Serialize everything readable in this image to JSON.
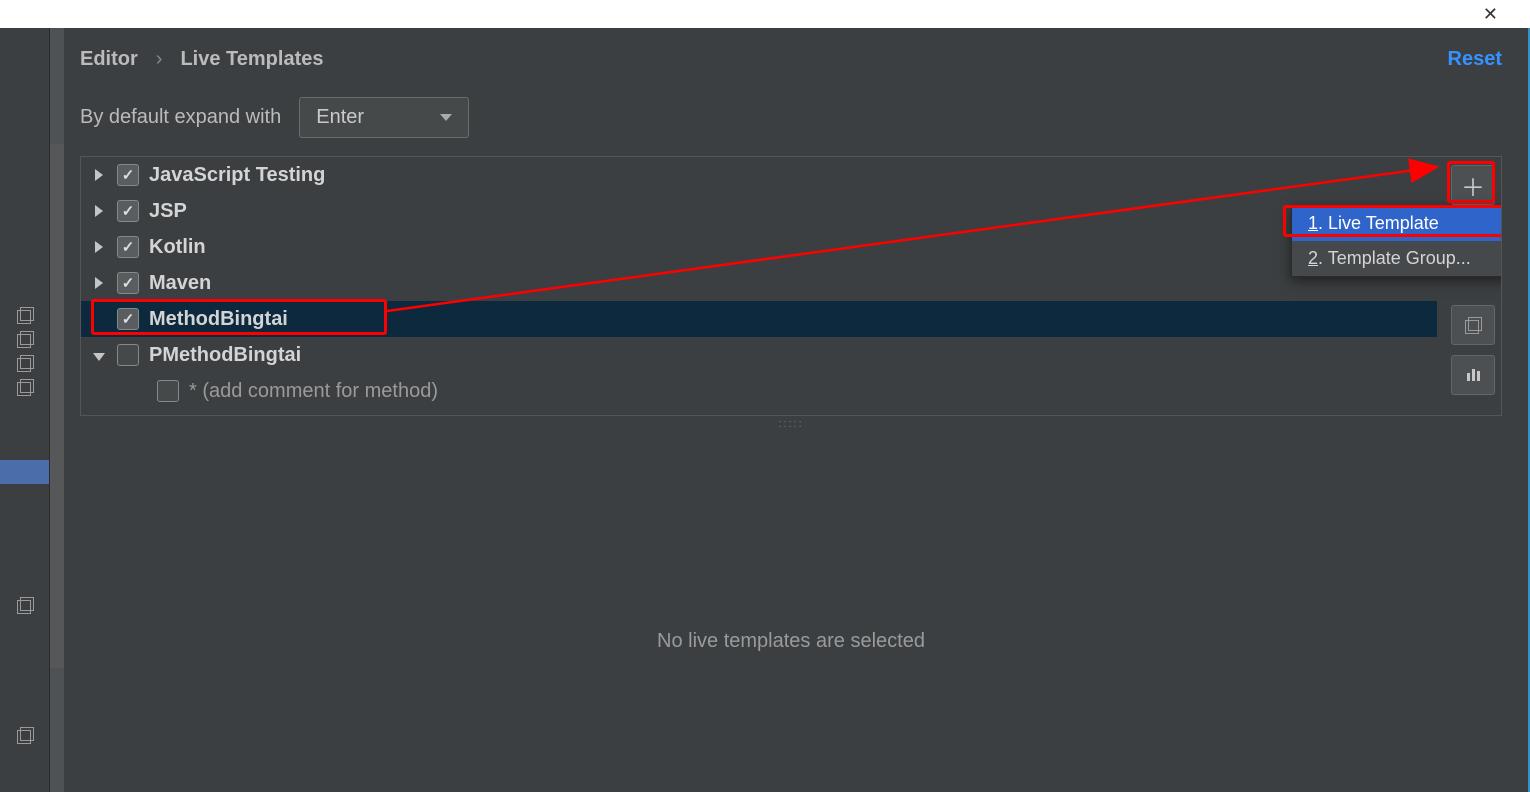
{
  "breadcrumb": {
    "parent": "Editor",
    "sep": "›",
    "current": "Live Templates"
  },
  "reset": "Reset",
  "expand": {
    "label": "By default expand with",
    "value": "Enter"
  },
  "tree": {
    "items": [
      {
        "label": "JavaScript Testing",
        "checked": true,
        "expandable": true,
        "open": false
      },
      {
        "label": "JSP",
        "checked": true,
        "expandable": true,
        "open": false
      },
      {
        "label": "Kotlin",
        "checked": true,
        "expandable": true,
        "open": false
      },
      {
        "label": "Maven",
        "checked": true,
        "expandable": true,
        "open": false
      },
      {
        "label": "MethodBingtai",
        "checked": true,
        "expandable": false,
        "open": false,
        "selected": true
      },
      {
        "label": "PMethodBingtai",
        "checked": false,
        "expandable": true,
        "open": true
      }
    ],
    "child": {
      "label": "* (add comment for method)",
      "checked": false
    }
  },
  "popup": {
    "item1_num": "1",
    "item1_label": ". Live Template",
    "item2_num": "2",
    "item2_label": ". Template Group..."
  },
  "empty": "No live templates are selected"
}
